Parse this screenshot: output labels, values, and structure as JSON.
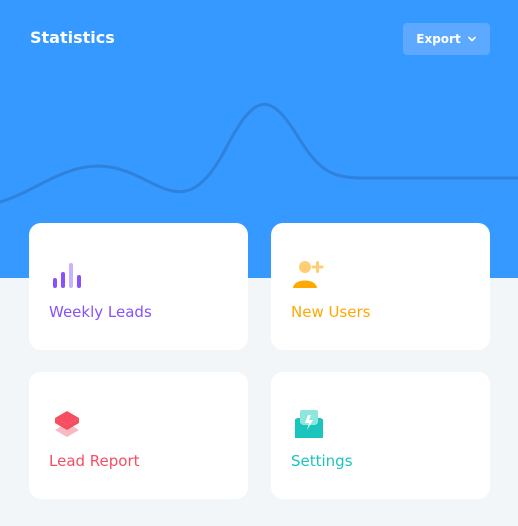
{
  "widget": {
    "title": "Statistics",
    "export_label": "Export"
  },
  "cards": [
    {
      "label": "Weekly Leads",
      "icon": "bar-chart-icon",
      "color": "#8950fc"
    },
    {
      "label": "New Users",
      "icon": "add-user-icon",
      "color": "#ffa800"
    },
    {
      "label": "Lead Report",
      "icon": "layers-icon",
      "color": "#f64e60"
    },
    {
      "label": "Settings",
      "icon": "mail-opened-icon",
      "color": "#1bc5bd"
    }
  ],
  "colors": {
    "header_bg": "#3699ff",
    "page_bg": "#f3f6f9"
  }
}
